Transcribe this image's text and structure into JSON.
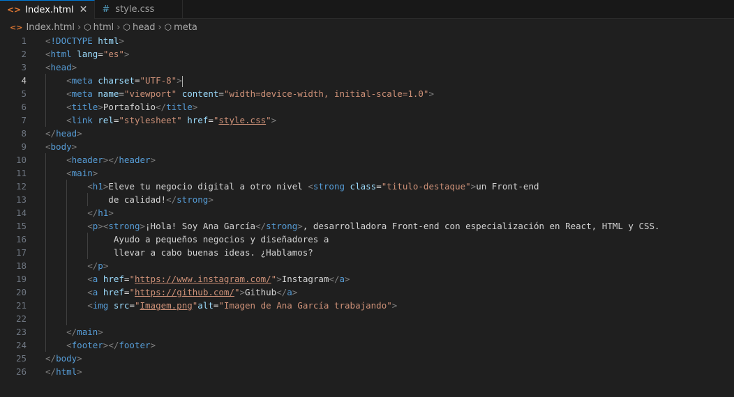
{
  "tabs": [
    {
      "label": "Index.html",
      "icon": "html-file-icon",
      "active": true
    },
    {
      "label": "style.css",
      "icon": "css-file-icon",
      "active": false
    }
  ],
  "breadcrumbs": [
    "Index.html",
    "html",
    "head",
    "meta"
  ],
  "colors": {
    "tag": "#569cd6",
    "attribute": "#9cdcfe",
    "string": "#ce9178",
    "bracket": "#808080",
    "text": "#d4d4d4",
    "active_tab_border": "#0078d4",
    "html_icon": "#e37933"
  },
  "editor": {
    "current_line": 4,
    "lines": [
      [
        [
          "br",
          "<"
        ],
        [
          "tag",
          "!DOCTYPE"
        ],
        [
          "txt",
          " "
        ],
        [
          "attr",
          "html"
        ],
        [
          "br",
          ">"
        ]
      ],
      [
        [
          "br",
          "<"
        ],
        [
          "tag",
          "html"
        ],
        [
          "txt",
          " "
        ],
        [
          "attr",
          "lang"
        ],
        [
          "txt",
          "="
        ],
        [
          "str",
          "\"es\""
        ],
        [
          "br",
          ">"
        ]
      ],
      [
        [
          "br",
          "<"
        ],
        [
          "tag",
          "head"
        ],
        [
          "br",
          ">"
        ]
      ],
      [
        [
          "txt",
          "    "
        ],
        [
          "br",
          "<"
        ],
        [
          "tag",
          "meta"
        ],
        [
          "txt",
          " "
        ],
        [
          "attr",
          "charset"
        ],
        [
          "txt",
          "="
        ],
        [
          "str",
          "\"UTF-8\""
        ],
        [
          "br",
          ">"
        ],
        [
          "cursor",
          ""
        ]
      ],
      [
        [
          "txt",
          "    "
        ],
        [
          "br",
          "<"
        ],
        [
          "tag",
          "meta"
        ],
        [
          "txt",
          " "
        ],
        [
          "attr",
          "name"
        ],
        [
          "txt",
          "="
        ],
        [
          "str",
          "\"viewport\""
        ],
        [
          "txt",
          " "
        ],
        [
          "attr",
          "content"
        ],
        [
          "txt",
          "="
        ],
        [
          "str",
          "\"width=device-width, initial-scale=1.0\""
        ],
        [
          "br",
          ">"
        ]
      ],
      [
        [
          "txt",
          "    "
        ],
        [
          "br",
          "<"
        ],
        [
          "tag",
          "title"
        ],
        [
          "br",
          ">"
        ],
        [
          "txt",
          "Portafolio"
        ],
        [
          "br",
          "</"
        ],
        [
          "tag",
          "title"
        ],
        [
          "br",
          ">"
        ]
      ],
      [
        [
          "txt",
          "    "
        ],
        [
          "br",
          "<"
        ],
        [
          "tag",
          "link"
        ],
        [
          "txt",
          " "
        ],
        [
          "attr",
          "rel"
        ],
        [
          "txt",
          "="
        ],
        [
          "str",
          "\"stylesheet\""
        ],
        [
          "txt",
          " "
        ],
        [
          "attr",
          "href"
        ],
        [
          "txt",
          "="
        ],
        [
          "str",
          "\""
        ],
        [
          "link",
          "style.css"
        ],
        [
          "str",
          "\""
        ],
        [
          "br",
          ">"
        ]
      ],
      [
        [
          "br",
          "</"
        ],
        [
          "tag",
          "head"
        ],
        [
          "br",
          ">"
        ]
      ],
      [
        [
          "br",
          "<"
        ],
        [
          "tag",
          "body"
        ],
        [
          "br",
          ">"
        ]
      ],
      [
        [
          "txt",
          "    "
        ],
        [
          "br",
          "<"
        ],
        [
          "tag",
          "header"
        ],
        [
          "br",
          "></"
        ],
        [
          "tag",
          "header"
        ],
        [
          "br",
          ">"
        ]
      ],
      [
        [
          "txt",
          "    "
        ],
        [
          "br",
          "<"
        ],
        [
          "tag",
          "main"
        ],
        [
          "br",
          ">"
        ]
      ],
      [
        [
          "txt",
          "        "
        ],
        [
          "br",
          "<"
        ],
        [
          "tag",
          "h1"
        ],
        [
          "br",
          ">"
        ],
        [
          "txt",
          "Eleve tu negocio digital a otro nivel "
        ],
        [
          "br",
          "<"
        ],
        [
          "tag",
          "strong"
        ],
        [
          "txt",
          " "
        ],
        [
          "attr",
          "class"
        ],
        [
          "txt",
          "="
        ],
        [
          "str",
          "\"titulo-destaque\""
        ],
        [
          "br",
          ">"
        ],
        [
          "txt",
          "un Front-end"
        ]
      ],
      [
        [
          "txt",
          "            de calidad!"
        ],
        [
          "br",
          "</"
        ],
        [
          "tag",
          "strong"
        ],
        [
          "br",
          ">"
        ]
      ],
      [
        [
          "txt",
          "        "
        ],
        [
          "br",
          "</"
        ],
        [
          "tag",
          "h1"
        ],
        [
          "br",
          ">"
        ]
      ],
      [
        [
          "txt",
          "        "
        ],
        [
          "br",
          "<"
        ],
        [
          "tag",
          "p"
        ],
        [
          "br",
          "><"
        ],
        [
          "tag",
          "strong"
        ],
        [
          "br",
          ">"
        ],
        [
          "txt",
          "¡Hola! Soy Ana García"
        ],
        [
          "br",
          "</"
        ],
        [
          "tag",
          "strong"
        ],
        [
          "br",
          ">"
        ],
        [
          "txt",
          ", desarrolladora Front-end con especialización en React, HTML y CSS."
        ]
      ],
      [
        [
          "txt",
          "             Ayudo a pequeños negocios y diseñadores a"
        ]
      ],
      [
        [
          "txt",
          "             llevar a cabo buenas ideas. ¿Hablamos?"
        ]
      ],
      [
        [
          "txt",
          "        "
        ],
        [
          "br",
          "</"
        ],
        [
          "tag",
          "p"
        ],
        [
          "br",
          ">"
        ]
      ],
      [
        [
          "txt",
          "        "
        ],
        [
          "br",
          "<"
        ],
        [
          "tag",
          "a"
        ],
        [
          "txt",
          " "
        ],
        [
          "attr",
          "href"
        ],
        [
          "txt",
          "="
        ],
        [
          "str",
          "\""
        ],
        [
          "link",
          "https://www.instagram.com/"
        ],
        [
          "str",
          "\""
        ],
        [
          "br",
          ">"
        ],
        [
          "txt",
          "Instagram"
        ],
        [
          "br",
          "</"
        ],
        [
          "tag",
          "a"
        ],
        [
          "br",
          ">"
        ]
      ],
      [
        [
          "txt",
          "        "
        ],
        [
          "br",
          "<"
        ],
        [
          "tag",
          "a"
        ],
        [
          "txt",
          " "
        ],
        [
          "attr",
          "href"
        ],
        [
          "txt",
          "="
        ],
        [
          "str",
          "\""
        ],
        [
          "link",
          "https://github.com/"
        ],
        [
          "str",
          "\""
        ],
        [
          "br",
          ">"
        ],
        [
          "txt",
          "Github"
        ],
        [
          "br",
          "</"
        ],
        [
          "tag",
          "a"
        ],
        [
          "br",
          ">"
        ]
      ],
      [
        [
          "txt",
          "        "
        ],
        [
          "br",
          "<"
        ],
        [
          "tag",
          "img"
        ],
        [
          "txt",
          " "
        ],
        [
          "attr",
          "src"
        ],
        [
          "txt",
          "="
        ],
        [
          "str",
          "\""
        ],
        [
          "link",
          "Imagem.png"
        ],
        [
          "str",
          "\""
        ],
        [
          "attr",
          "alt"
        ],
        [
          "txt",
          "="
        ],
        [
          "str",
          "\"Imagen de Ana García trabajando\""
        ],
        [
          "br",
          ">"
        ]
      ],
      [],
      [
        [
          "txt",
          "    "
        ],
        [
          "br",
          "</"
        ],
        [
          "tag",
          "main"
        ],
        [
          "br",
          ">"
        ]
      ],
      [
        [
          "txt",
          "    "
        ],
        [
          "br",
          "<"
        ],
        [
          "tag",
          "footer"
        ],
        [
          "br",
          "></"
        ],
        [
          "tag",
          "footer"
        ],
        [
          "br",
          ">"
        ]
      ],
      [
        [
          "br",
          "</"
        ],
        [
          "tag",
          "body"
        ],
        [
          "br",
          ">"
        ]
      ],
      [
        [
          "br",
          "</"
        ],
        [
          "tag",
          "html"
        ],
        [
          "br",
          ">"
        ]
      ]
    ]
  }
}
